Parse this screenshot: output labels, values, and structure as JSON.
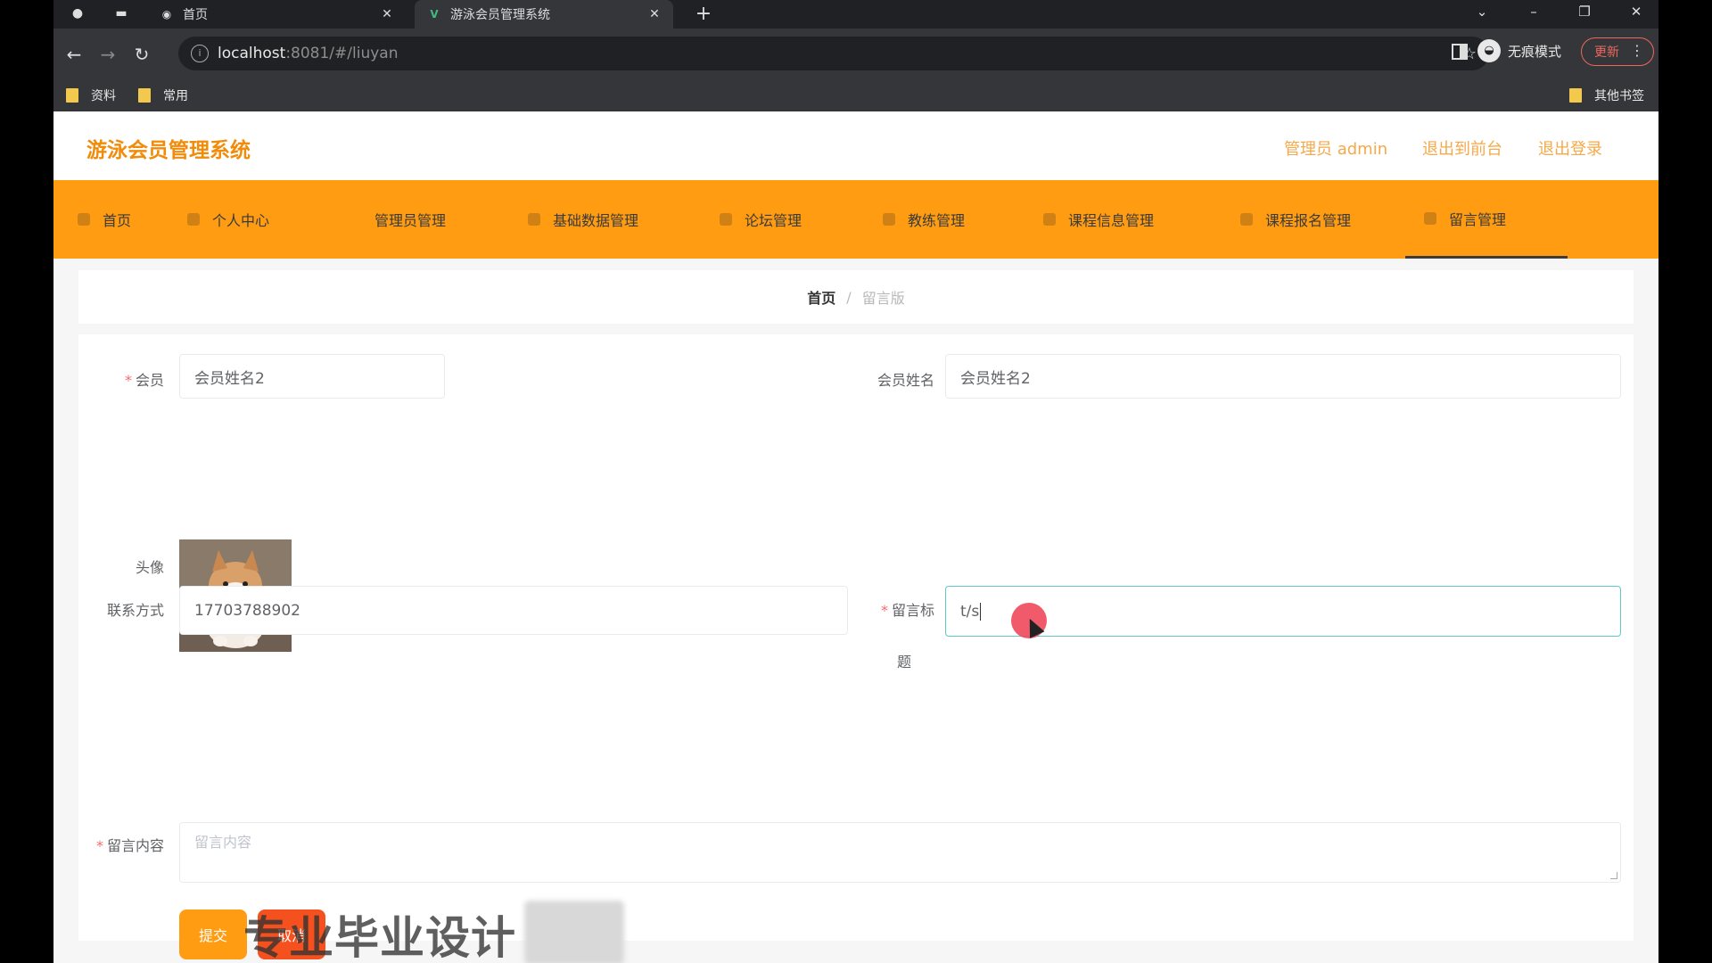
{
  "browser": {
    "tabs": [
      {
        "title": "首页",
        "close": "✕"
      },
      {
        "title": "游泳会员管理系统",
        "close": "✕"
      }
    ],
    "new_tab": "+",
    "url_host": "localhost",
    "url_path": ":8081/#/liuyan",
    "incognito_label": "无痕模式",
    "update_label": "更新",
    "bookmarks": [
      "资料",
      "常用"
    ],
    "other_bookmarks": "其他书签"
  },
  "header": {
    "brand": "游泳会员管理系统",
    "links": [
      "管理员 admin",
      "退出到前台",
      "退出登录"
    ]
  },
  "menu": {
    "items": [
      "首页",
      "个人中心",
      "管理员管理",
      "基础数据管理",
      "论坛管理",
      "教练管理",
      "课程信息管理",
      "课程报名管理",
      "留言管理"
    ],
    "active_index": 8
  },
  "breadcrumb": {
    "home": "首页",
    "separator": "/",
    "current": "留言版"
  },
  "form": {
    "member_label": "会员",
    "member_value": "会员姓名2",
    "member_name_label": "会员姓名",
    "member_name_value": "会员姓名2",
    "avatar_label": "头像",
    "phone_label": "联系方式",
    "phone_value": "17703788902",
    "title_label_line1": "留言标",
    "title_label_line2": "题",
    "title_value": "t/s",
    "content_label": "留言内容",
    "content_placeholder": "留言内容",
    "submit_label": "提交",
    "cancel_label": "取消"
  },
  "watermark": "专业毕业设计",
  "colors": {
    "brand": "#f08c0a",
    "menubar": "#ff9c12",
    "focus_border": "#5fc9c3",
    "submit": "#ff9c12",
    "cancel": "#f4511e"
  }
}
